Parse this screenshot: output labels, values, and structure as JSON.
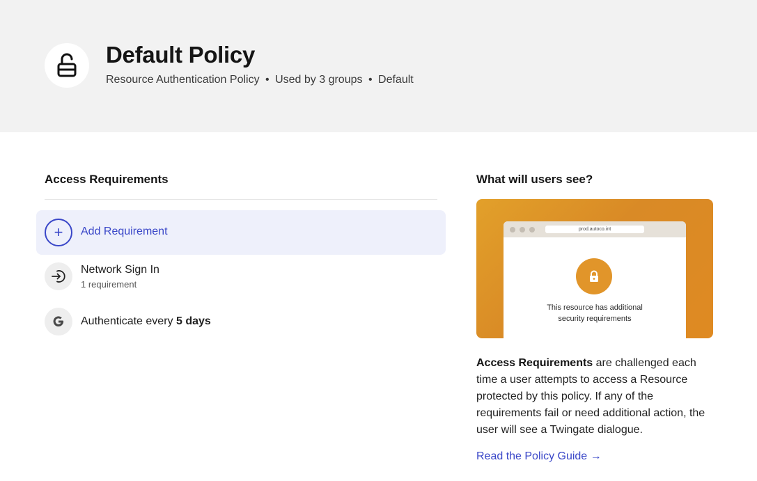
{
  "header": {
    "title": "Default Policy",
    "subtitle_type": "Resource Authentication Policy",
    "subtitle_sep": "•",
    "subtitle_usage": "Used by 3 groups",
    "subtitle_default": "Default",
    "icon": "unlocked-padlock-icon"
  },
  "access_requirements": {
    "title": "Access Requirements",
    "add_label": "Add Requirement",
    "add_icon": "+",
    "items": [
      {
        "icon": "sign-in-icon",
        "title": "Network Sign In",
        "subtitle": "1 requirement"
      },
      {
        "icon": "google-icon",
        "title_prefix": "Authenticate every",
        "title_emphasis": "5 days"
      }
    ]
  },
  "preview": {
    "title": "What will users see?",
    "url": "prod.autoco.int",
    "message_line1": "This resource has additional",
    "message_line2": "security requirements",
    "icon": "lock-icon",
    "accent_color": "#df8d24"
  },
  "description": {
    "bold": "Access Requirements",
    "text": " are challenged each time a user attempts to access a Resource protected by this policy. If any of the requirements fail or need additional action, the user will see a Twingate dialogue."
  },
  "guide_link": {
    "label": "Read the Policy Guide →"
  },
  "colors": {
    "header_bg": "#f2f2f2",
    "accent_blue": "#3a47c8",
    "add_bg": "#eef0fb"
  }
}
